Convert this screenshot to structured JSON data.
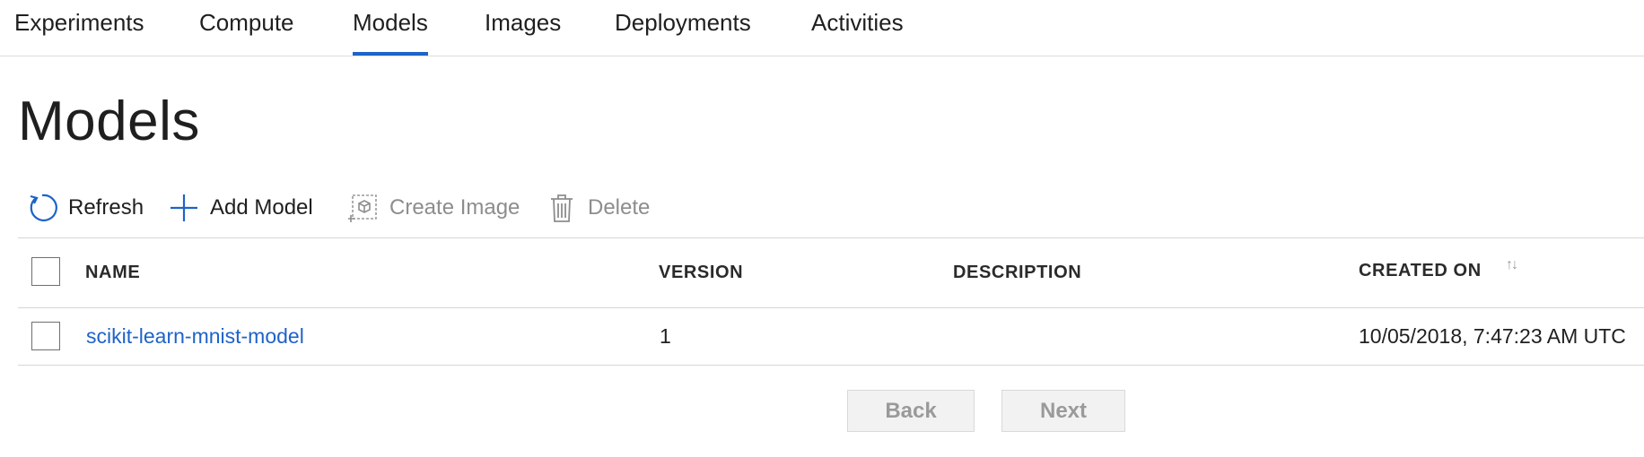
{
  "tabs": [
    {
      "label": "Experiments",
      "active": false
    },
    {
      "label": "Compute",
      "active": false
    },
    {
      "label": "Models",
      "active": true
    },
    {
      "label": "Images",
      "active": false
    },
    {
      "label": "Deployments",
      "active": false
    },
    {
      "label": "Activities",
      "active": false
    }
  ],
  "page": {
    "title": "Models"
  },
  "toolbar": {
    "refresh": {
      "label": "Refresh",
      "icon": "refresh-icon",
      "enabled": true
    },
    "add_model": {
      "label": "Add Model",
      "icon": "plus-icon",
      "enabled": true
    },
    "create_image": {
      "label": "Create Image",
      "icon": "create-image-icon",
      "enabled": false
    },
    "delete": {
      "label": "Delete",
      "icon": "trash-icon",
      "enabled": false
    }
  },
  "table": {
    "columns": {
      "name": "NAME",
      "version": "VERSION",
      "description": "DESCRIPTION",
      "created_on": "CREATED ON"
    },
    "sort_icon": "↑↓",
    "rows": [
      {
        "name": "scikit-learn-mnist-model",
        "version": "1",
        "description": "",
        "created_on": "10/05/2018, 7:47:23 AM UTC"
      }
    ]
  },
  "pager": {
    "back": "Back",
    "next": "Next"
  },
  "colors": {
    "accent": "#1e63c8",
    "disabled_text": "#8d8d8d"
  }
}
